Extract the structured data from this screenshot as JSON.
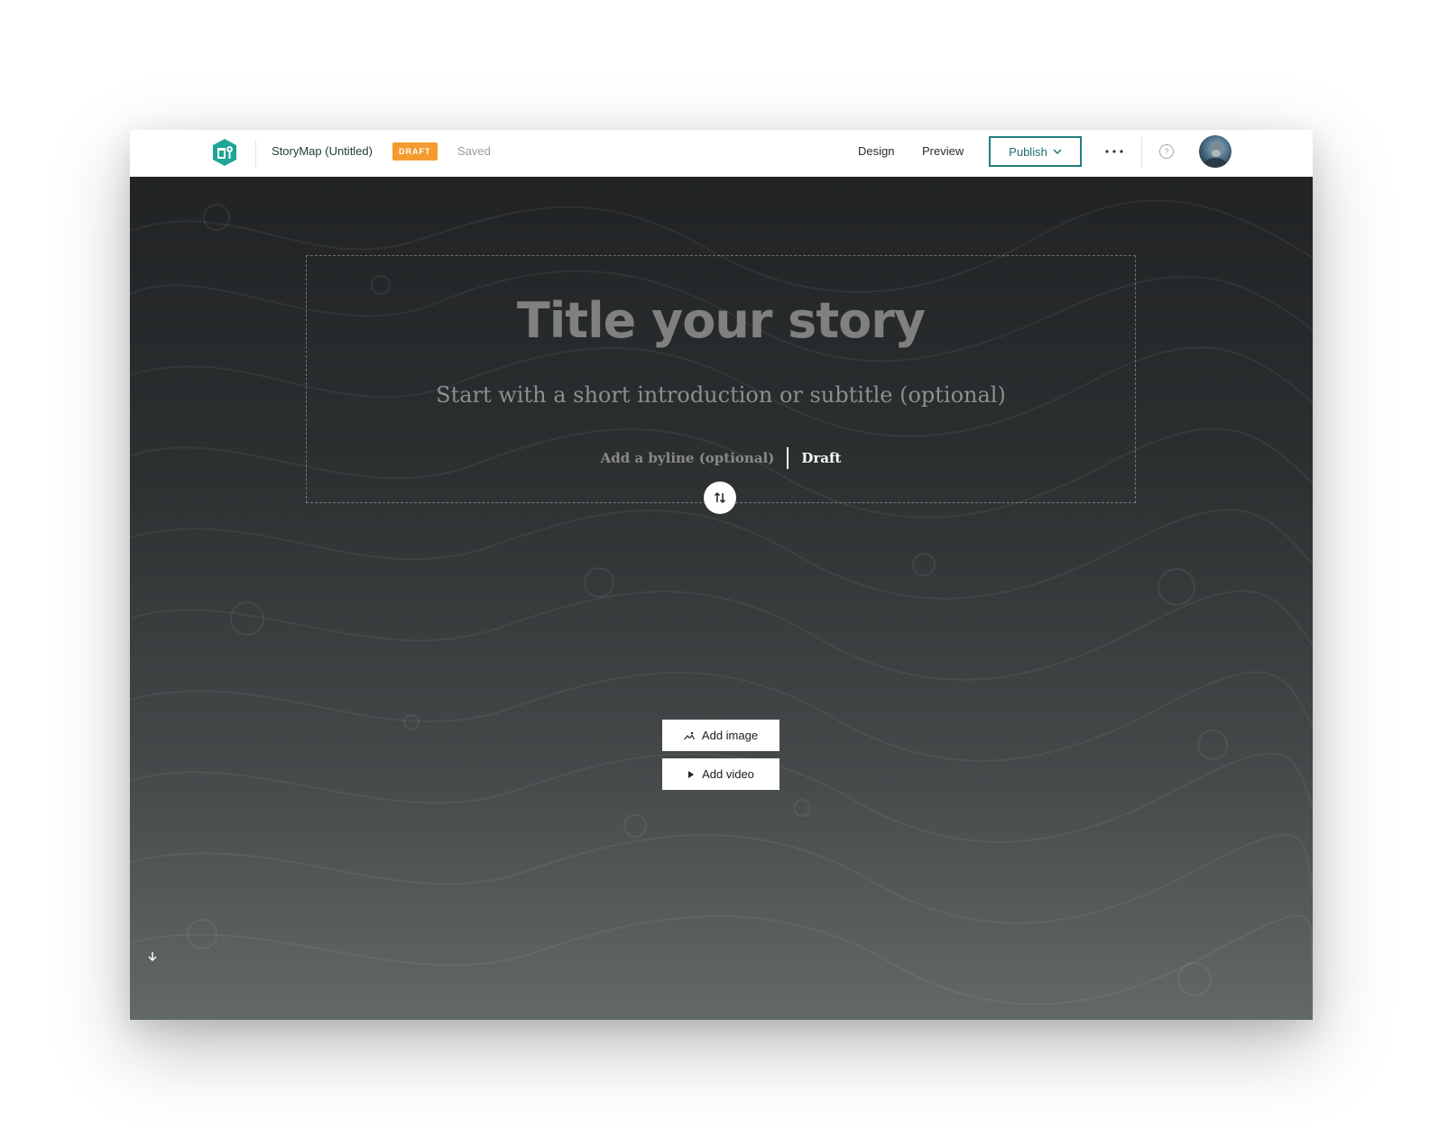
{
  "header": {
    "logo_icon": "storymaps-logo-icon",
    "story_title": "StoryMap (Untitled)",
    "draft_badge": "DRAFT",
    "save_status": "Saved",
    "nav": {
      "design_label": "Design",
      "preview_label": "Preview"
    },
    "publish_label": "Publish",
    "more_icon": "more-horizontal-icon",
    "help_icon": "question-icon",
    "avatar": "user-avatar"
  },
  "cover": {
    "title_placeholder": "Title your story",
    "subtitle_placeholder": "Start with a short introduction or subtitle (optional)",
    "byline_placeholder": "Add a byline (optional)",
    "byline_status": "Draft",
    "swap_icon": "swap-vertical-icon",
    "add_image_label": "Add image",
    "add_video_label": "Add video",
    "scroll_icon": "arrow-down-icon"
  },
  "colors": {
    "accent": "#1f7f7e",
    "draft_badge": "#f59a2f",
    "cover_top": "#212325",
    "cover_bottom": "#636868"
  }
}
